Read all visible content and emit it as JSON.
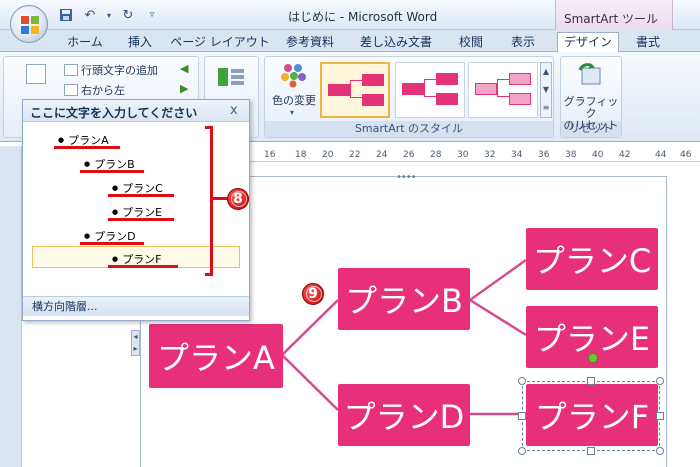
{
  "window": {
    "title": "はじめに - Microsoft Word",
    "context_tab_label": "SmartArt ツール"
  },
  "ribbon": {
    "tabs": [
      "ホーム",
      "挿入",
      "ページ レイアウト",
      "参考資料",
      "差し込み文書",
      "校閲",
      "表示",
      "デザイン",
      "書式"
    ],
    "active_tab": "デザイン",
    "create_graphic": {
      "add_bullet": "行頭文字の追加",
      "right_to_left": "右から左"
    },
    "change_colors": "色の変更",
    "styles_group_label": "SmartArt のスタイル",
    "reset_graphic": "グラフィック\nのリセット",
    "reset_group_label": "リセット"
  },
  "text_pane": {
    "title": "ここに文字を入力してください",
    "close": "x",
    "items": [
      "プランA",
      "プランB",
      "プランC",
      "プランE",
      "プランD",
      "プランF"
    ],
    "footer": "横方向階層..."
  },
  "ruler": {
    "marks": [
      "16",
      "18",
      "20",
      "22",
      "24",
      "26",
      "28",
      "30",
      "32",
      "34",
      "36",
      "38",
      "40",
      "42",
      "44",
      "46"
    ]
  },
  "smartart": {
    "nodes": [
      "プランA",
      "プランB",
      "プランC",
      "プランE",
      "プランD",
      "プランF"
    ],
    "color": "#e8307a"
  },
  "badges": {
    "step8": "8",
    "step9": "9"
  }
}
